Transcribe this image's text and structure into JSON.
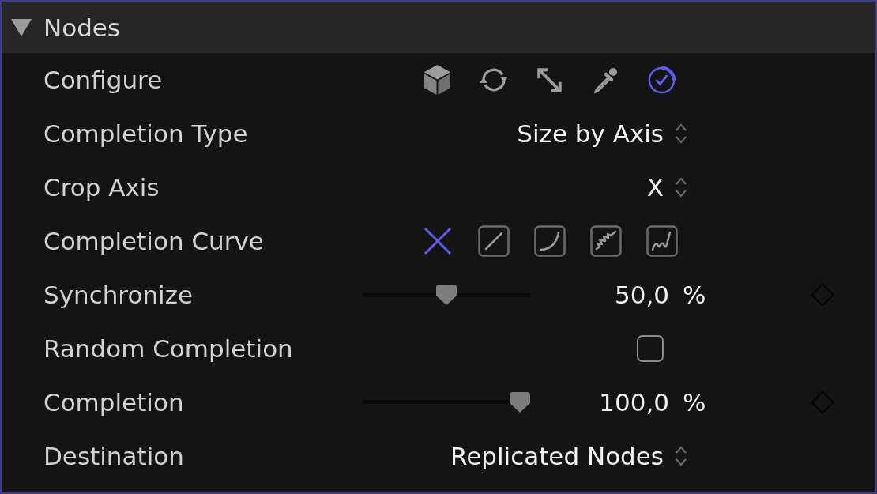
{
  "section": {
    "title": "Nodes",
    "expanded": true
  },
  "rows": [
    {
      "kind": "tool_buttons",
      "label": "Configure",
      "options": [
        {
          "selected": false
        },
        {
          "selected": false
        },
        {
          "selected": false
        },
        {
          "selected": false
        },
        {
          "selected": true
        }
      ]
    },
    {
      "kind": "popup",
      "label": "Completion Type",
      "value": "Size by Axis"
    },
    {
      "kind": "popup",
      "label": "Crop Axis",
      "value": "X"
    },
    {
      "kind": "curve_buttons",
      "label": "Completion Curve",
      "options": [
        {
          "selected": true
        },
        {
          "selected": false
        },
        {
          "selected": false
        },
        {
          "selected": false
        },
        {
          "selected": false
        }
      ]
    },
    {
      "kind": "slider",
      "label": "Synchronize",
      "level": 0.5,
      "reading": "50,0",
      "unit": "%"
    },
    {
      "kind": "checkbox",
      "label": "Random Completion",
      "checked": false
    },
    {
      "kind": "slider",
      "label": "Completion",
      "level": 1,
      "reading": "100,0",
      "unit": "%"
    },
    {
      "kind": "popup",
      "label": "Destination",
      "value": "Replicated Nodes"
    }
  ]
}
